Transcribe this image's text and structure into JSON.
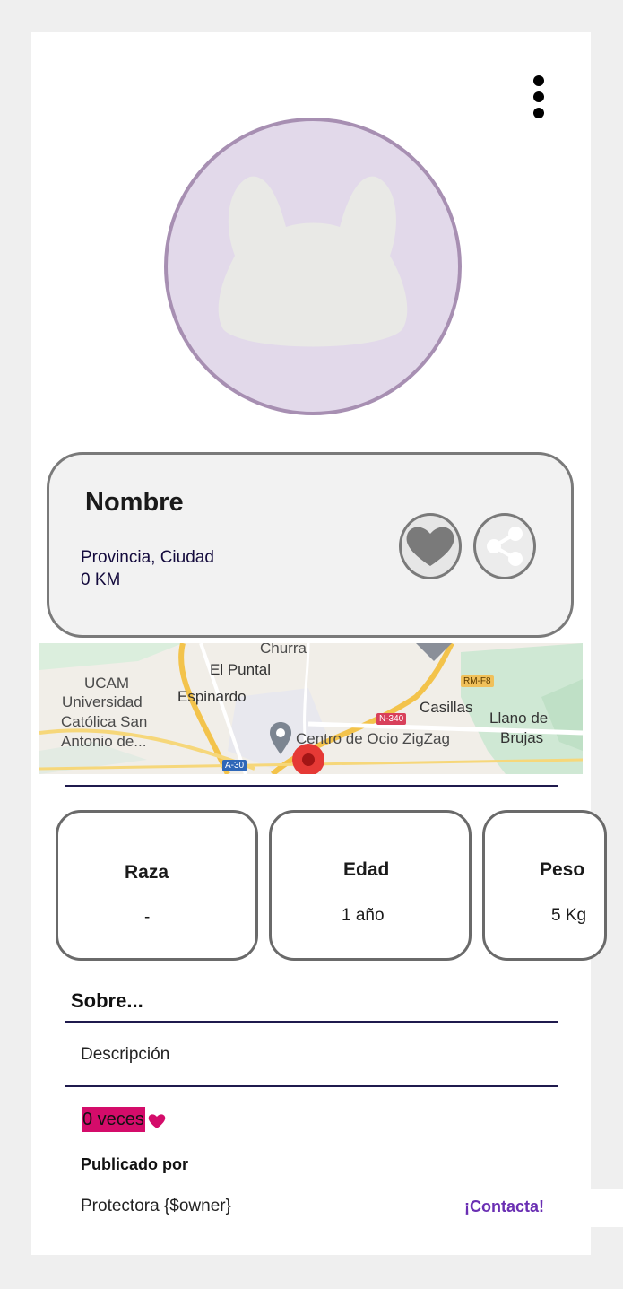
{
  "pet": {
    "name": "Nombre",
    "location": "Provincia, Ciudad",
    "distance": "0 KM"
  },
  "map": {
    "labels": {
      "churra": "Churra",
      "el_puntal": "El Puntal",
      "ucam": "UCAM",
      "universidad": "Universidad",
      "catolica": "Católica San",
      "antonio": "Antonio de...",
      "espinardo": "Espinardo",
      "casillas": "Casillas",
      "llano": "Llano de",
      "brujas": "Brujas",
      "centro": "Centro de Ocio ZigZag"
    },
    "badges": {
      "rm_f8": "RM-F8",
      "n340": "N-340",
      "a30": "A-30"
    }
  },
  "stats": {
    "breed_label": "Raza",
    "breed_value": "-",
    "age_label": "Edad",
    "age_value": "1 año",
    "weight_label": "Peso",
    "weight_value": "5 Kg"
  },
  "about": {
    "title": "Sobre...",
    "description": "Descripción"
  },
  "likes": {
    "text": "0 veces"
  },
  "publisher": {
    "label": "Publicado por",
    "owner": "Protectora {$owner}",
    "contact": "¡Contacta!"
  },
  "icons": {
    "menu": "more-vertical-icon",
    "favorite": "heart-icon",
    "share": "share-icon",
    "likes": "heart-icon",
    "avatar": "pet-silhouette-icon",
    "map_pin": "location-pin-icon"
  },
  "colors": {
    "avatar_bg": "#e2d9ea",
    "avatar_border": "#a78fb2",
    "likes_highlight": "#d40c6a",
    "contact": "#6a2fb3",
    "divider": "#1f1a4d"
  }
}
